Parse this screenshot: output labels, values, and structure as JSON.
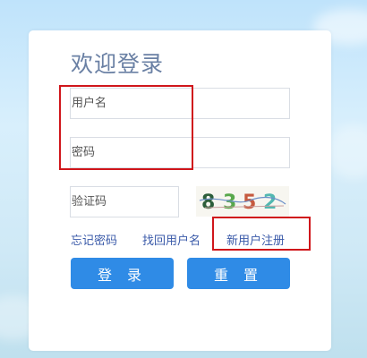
{
  "login": {
    "title": "欢迎登录",
    "username_placeholder": "用户名",
    "password_placeholder": "密码",
    "captcha_placeholder": "验证码",
    "captcha_text": "8352",
    "forgot_password": "忘记密码",
    "find_username": "找回用户名",
    "register": "新用户注册",
    "login_button": "登 录",
    "reset_button": "重 置"
  },
  "colors": {
    "primary_button": "#2f8be6",
    "title": "#6a80a4",
    "link": "#3a5aa9",
    "highlight_box": "#d0161b"
  }
}
